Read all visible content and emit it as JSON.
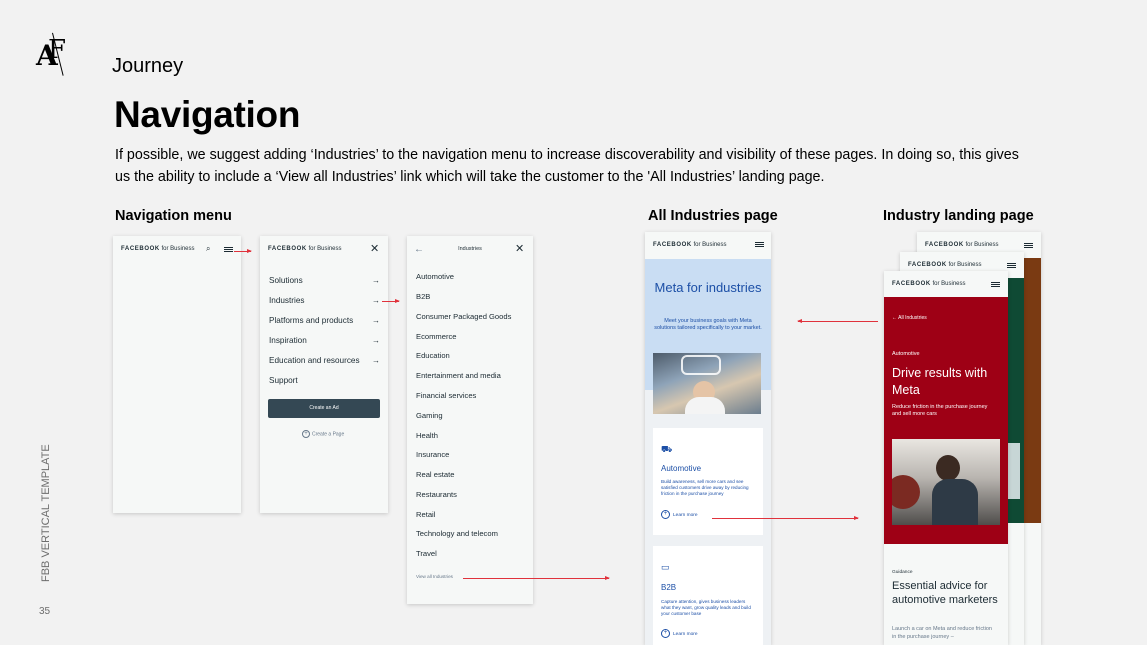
{
  "header": {
    "section": "Journey",
    "title": "Navigation",
    "description": "If possible, we suggest adding ‘Industries’ to the navigation menu to increase discoverability and visibility of these pages. In doing so, this gives us the ability to include a ‘View all Industries’ link which will take the customer to the 'All Industries’ landing page."
  },
  "sidebar": {
    "template_label": "FBB VERTICAL TEMPLATE",
    "page_number": "35"
  },
  "columns": {
    "nav_menu": "Navigation menu",
    "all_industries": "All Industries page",
    "industry_landing": "Industry landing page"
  },
  "brand": {
    "name": "FACEBOOK",
    "suffix": "for Business"
  },
  "menu": {
    "items": [
      "Solutions",
      "Industries",
      "Platforms and products",
      "Inspiration",
      "Education and resources",
      "Support"
    ],
    "cta": "Create an Ad",
    "secondary": "Create a Page"
  },
  "industries_menu": {
    "title": "Industries",
    "items": [
      "Automotive",
      "B2B",
      "Consumer Packaged Goods",
      "Ecommerce",
      "Education",
      "Entertainment and media",
      "Financial services",
      "Gaming",
      "Health",
      "Insurance",
      "Real estate",
      "Restaurants",
      "Retail",
      "Technology and telecom",
      "Travel"
    ],
    "view_all": "View all Industries"
  },
  "all_industries_page": {
    "hero_title": "Meta for industries",
    "hero_text": "Meet your business goals with Meta solutions tailored specifically to your market.",
    "cards": [
      {
        "title": "Automotive",
        "text": "Build awareness, sell more cars and see satisfied customers drive away by reducing friction in the purchase journey",
        "link": "Learn more"
      },
      {
        "title": "B2B",
        "text": "Capture attention, gives business leaders what they want, grow quality leads and build your customer base",
        "link": "Learn more"
      }
    ]
  },
  "industry_page": {
    "back": "All Industries",
    "eyebrow": "Automotive",
    "title": "Drive results with Meta",
    "text": "Reduce friction in the purchase journey and sell more cars",
    "guidance_label": "Guidance",
    "guidance_title": "Essential advice for automotive marketers",
    "guidance_text": "Launch a car on Meta and reduce friction in the purchase journey –"
  },
  "colors": {
    "accent_red": "#e0323c",
    "hero_blue": "#c9ddf3",
    "landing_red": "#9e0015",
    "landing_green": "#0f4a34",
    "landing_brown": "#7a3a12",
    "cta_dark": "#344854"
  }
}
